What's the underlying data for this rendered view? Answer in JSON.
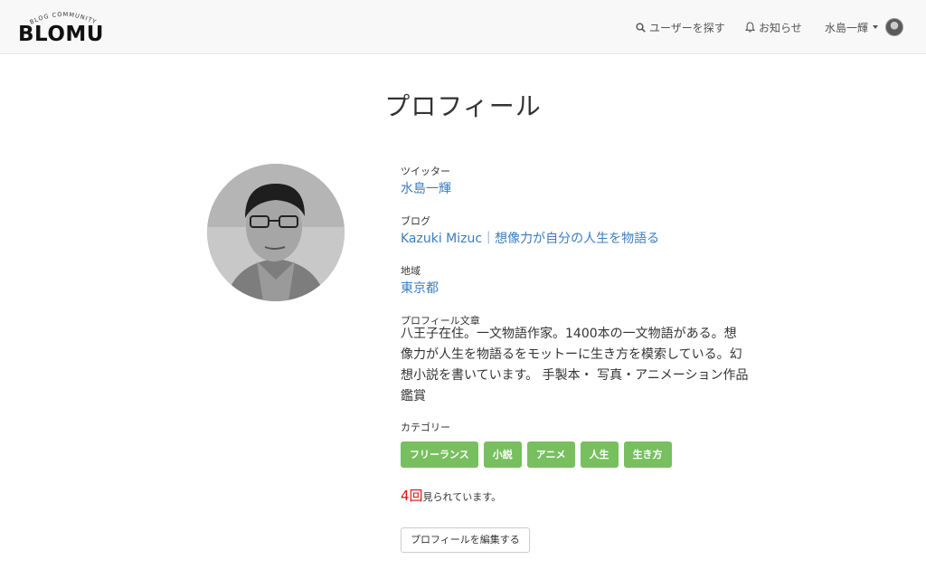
{
  "header": {
    "logo_tagline": "BLOG COMMUNITY",
    "logo_text": "BLOMU",
    "search_label": "ユーザーを探す",
    "notice_label": "お知らせ",
    "user_name": "水島一輝"
  },
  "profile": {
    "title": "プロフィール",
    "twitter_label": "ツイッター",
    "twitter_value": "水島一輝",
    "blog_label": "ブログ",
    "blog_value": "Kazuki Mizuc｜想像力が自分の人生を物語る",
    "region_label": "地域",
    "region_value": "東京都",
    "bio_label": "プロフィール文章",
    "bio_text": "八王子在住。一文物語作家。1400本の一文物語がある。想像力が人生を物語るをモットーに生き方を模索している。幻想小説を書いています。 手製本・ 写真・アニメーション作品鑑賞",
    "category_label": "カテゴリー",
    "categories": [
      "フリーランス",
      "小説",
      "アニメ",
      "人生",
      "生き方"
    ],
    "views_count": "4回",
    "views_suffix": "見られています。",
    "edit_button": "プロフィールを編集する"
  },
  "colors": {
    "link": "#3a7dbf",
    "tag": "#78bf5f",
    "views_count": "#e01010"
  }
}
